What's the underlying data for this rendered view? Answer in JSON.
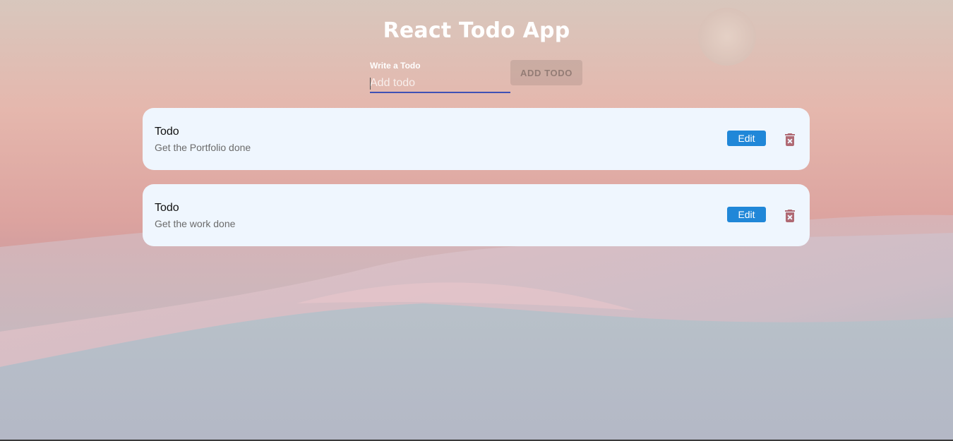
{
  "app": {
    "title": "React Todo App"
  },
  "form": {
    "label": "Write a Todo",
    "placeholder": "Add todo",
    "value": "",
    "add_button_label": "ADD TODO"
  },
  "todos": [
    {
      "heading": "Todo",
      "text": "Get the Portfolio done",
      "edit_label": "Edit",
      "delete_icon": "delete-forever-icon"
    },
    {
      "heading": "Todo",
      "text": "Get the work done",
      "edit_label": "Edit",
      "delete_icon": "delete-forever-icon"
    }
  ],
  "colors": {
    "accent": "#3f51b5",
    "edit_button": "#2087d8",
    "card_background": "#eff6fe",
    "delete_icon": "#b06a74"
  }
}
